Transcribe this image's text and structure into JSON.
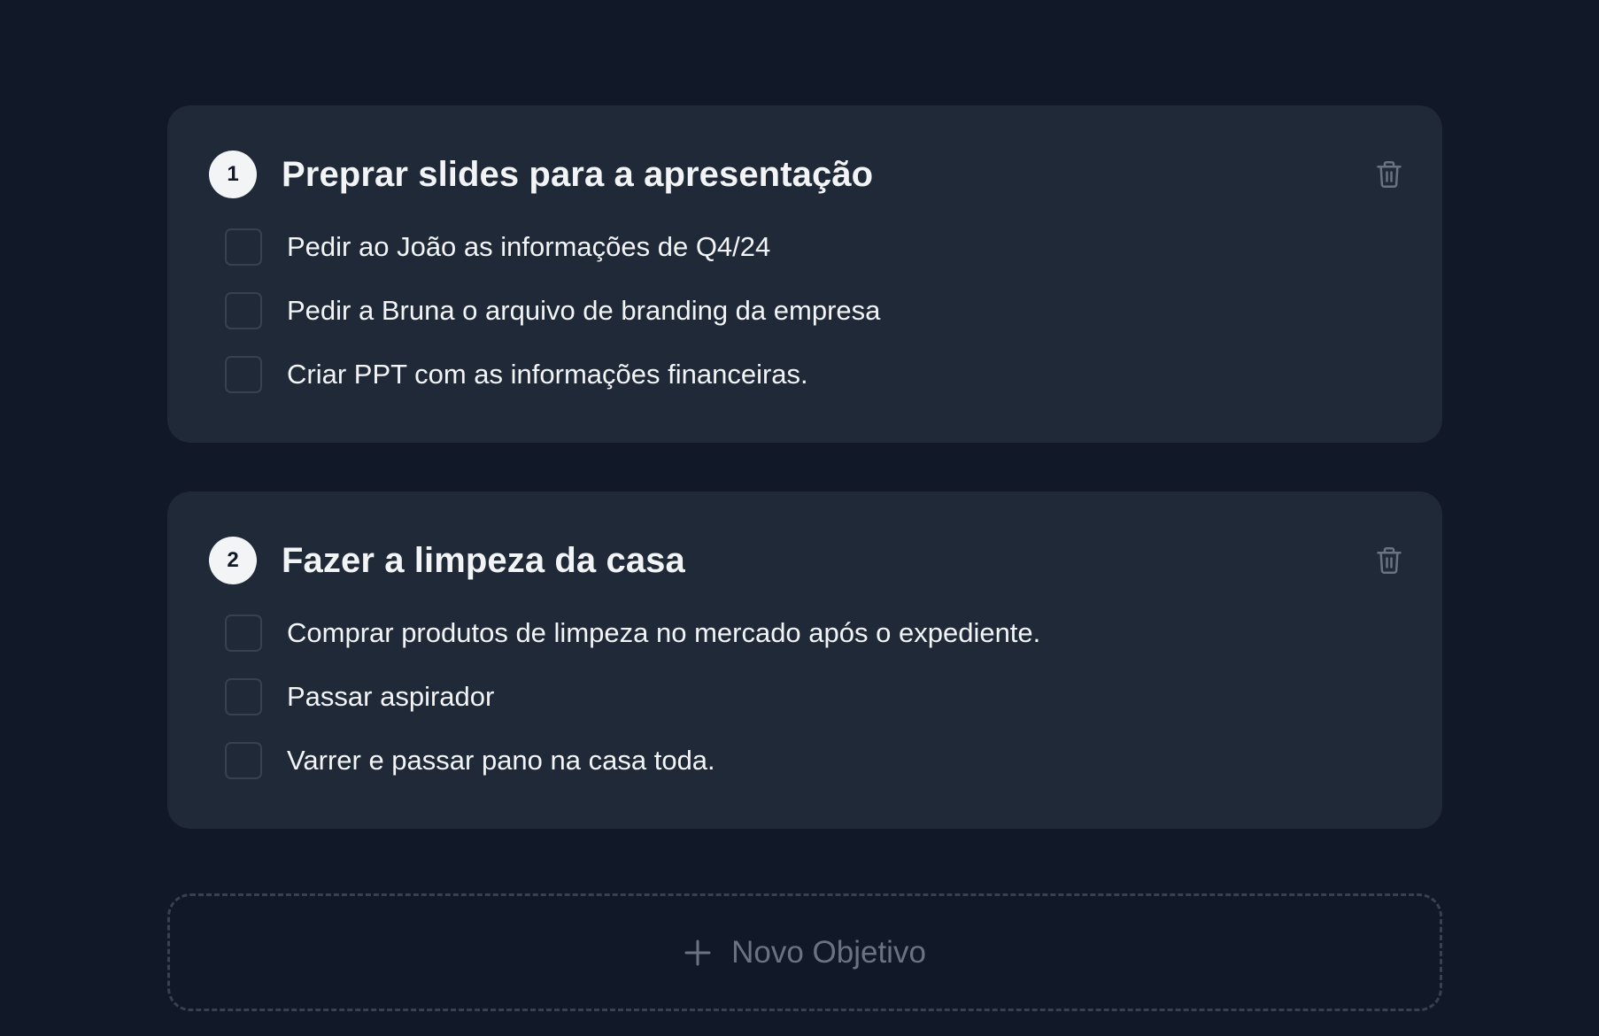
{
  "objectives": [
    {
      "number": "1",
      "title": "Preprar slides para a apresentação",
      "delete_icon": "trash-icon",
      "tasks": [
        {
          "label": "Pedir ao João as informações de Q4/24",
          "checked": false
        },
        {
          "label": "Pedir a Bruna o arquivo de branding da empresa",
          "checked": false
        },
        {
          "label": "Criar PPT com as informações financeiras.",
          "checked": false
        }
      ]
    },
    {
      "number": "2",
      "title": "Fazer a limpeza da casa",
      "delete_icon": "trash-icon",
      "tasks": [
        {
          "label": "Comprar produtos de limpeza no mercado após o expediente.",
          "checked": false
        },
        {
          "label": "Passar aspirador",
          "checked": false
        },
        {
          "label": "Varrer e passar pano na casa toda.",
          "checked": false
        }
      ]
    }
  ],
  "add_objective": {
    "icon": "plus-icon",
    "label": "Novo Objetivo"
  },
  "colors": {
    "page_background": "#111827",
    "card_background": "#1f2937",
    "badge_background": "#f3f4f6",
    "text_primary": "#f3f4f6",
    "text_muted": "#6b7280",
    "border": "#374151"
  }
}
